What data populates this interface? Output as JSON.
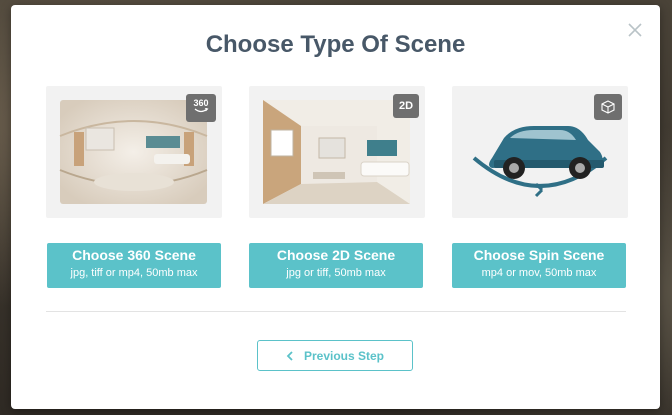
{
  "modal": {
    "title": "Choose Type Of Scene",
    "close_icon": "close-icon"
  },
  "cards": [
    {
      "badge": "360",
      "badge_icon": "360-rotate-icon",
      "button_title": "Choose 360 Scene",
      "button_subtitle": "jpg, tiff or mp4, 50mb max"
    },
    {
      "badge": "2D",
      "button_title": "Choose 2D Scene",
      "button_subtitle": "jpg or tiff, 50mb max"
    },
    {
      "badge_icon": "cube-icon",
      "button_title": "Choose Spin Scene",
      "button_subtitle": "mp4 or mov, 50mb max"
    }
  ],
  "footer": {
    "previous_label": "Previous Step",
    "previous_icon": "chevron-left-icon"
  },
  "colors": {
    "accent": "#5bc2c9",
    "title": "#485868",
    "badge": "#6f6f6f",
    "car": "#2f6f86"
  }
}
